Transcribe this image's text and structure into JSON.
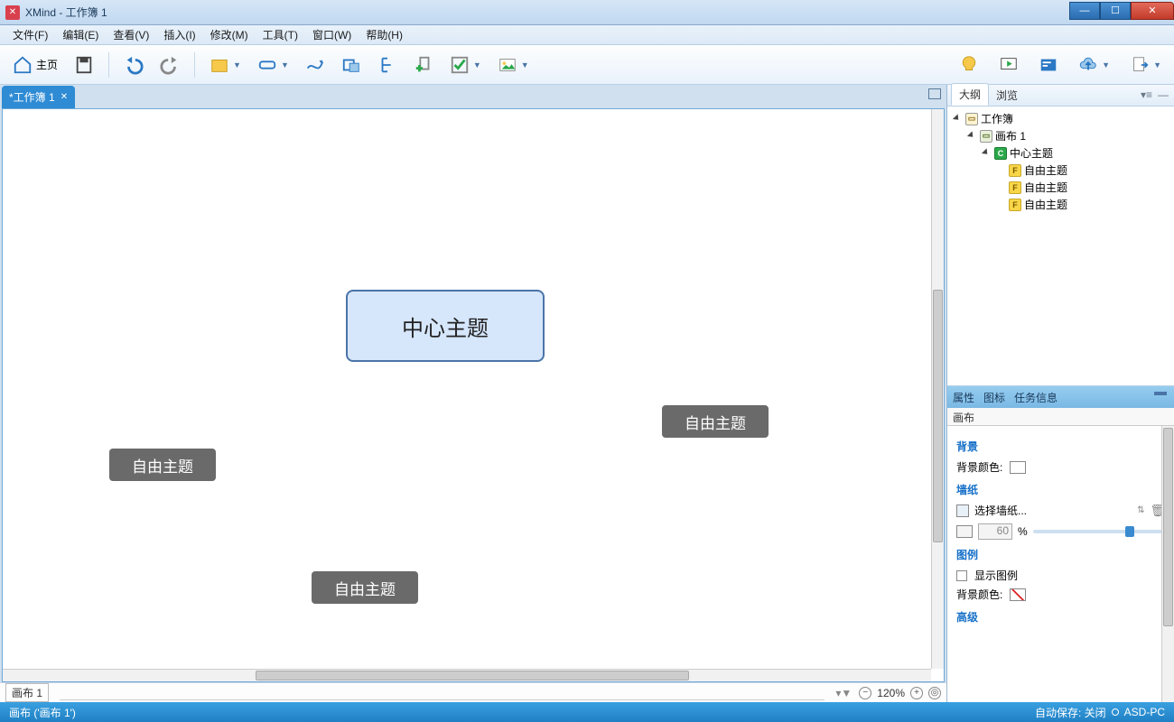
{
  "title": "XMind - 工作簿 1",
  "menus": [
    "文件(F)",
    "编辑(E)",
    "查看(V)",
    "插入(I)",
    "修改(M)",
    "工具(T)",
    "窗口(W)",
    "帮助(H)"
  ],
  "home_label": "主页",
  "tabs": [
    {
      "label": "*工作簿 1"
    }
  ],
  "canvas": {
    "center": "中心主题",
    "free_nodes": [
      "自由主题",
      "自由主题",
      "自由主题"
    ]
  },
  "sheet_name": "画布 1",
  "zoom": "120%",
  "outline_tabs": [
    "大纲",
    "浏览"
  ],
  "outline_tree": {
    "workbook": "工作簿",
    "sheet": "画布 1",
    "center": "中心主题",
    "free": [
      "自由主题",
      "自由主题",
      "自由主题"
    ]
  },
  "prop_tabs": [
    "属性",
    "图标",
    "任务信息"
  ],
  "prop_subtitle": "画布",
  "props": {
    "bg_section": "背景",
    "bg_color_label": "背景颜色:",
    "wall_section": "墙纸",
    "wall_select": "选择墙纸...",
    "opacity": "60",
    "pct": "%",
    "legend_section": "图例",
    "show_legend": "显示图例",
    "legend_bg": "背景颜色:",
    "advanced": "高级"
  },
  "status_left": "画布 ('画布 1')",
  "status_autosave": "自动保存: 关闭",
  "status_host": "ASD-PC"
}
